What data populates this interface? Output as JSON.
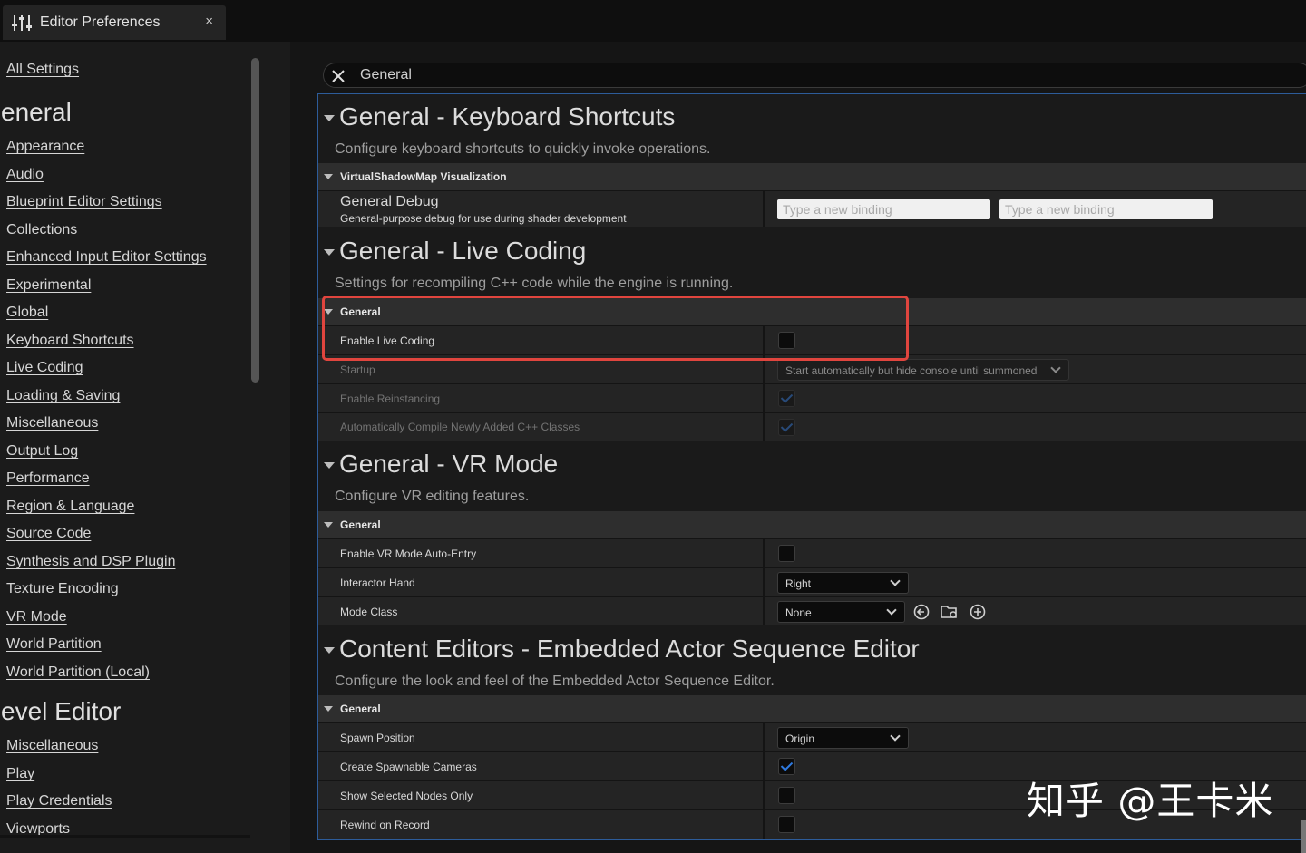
{
  "tab": {
    "title": "Editor Preferences",
    "close": "×"
  },
  "search": {
    "value": "General"
  },
  "sidebar": {
    "all_settings": "All Settings",
    "groups": [
      {
        "heading": "eneral",
        "items": [
          "Appearance",
          "Audio",
          "Blueprint Editor Settings",
          "Collections",
          "Enhanced Input Editor Settings",
          "Experimental",
          "Global",
          "Keyboard Shortcuts",
          "Live Coding",
          "Loading & Saving",
          "Miscellaneous",
          "Output Log",
          "Performance",
          "Region & Language",
          "Source Code",
          "Synthesis and DSP Plugin",
          "Texture Encoding",
          "VR Mode",
          "World Partition",
          "World Partition (Local)"
        ]
      },
      {
        "heading": "evel Editor",
        "items": [
          "Miscellaneous",
          "Play",
          "Play Credentials",
          "Viewports"
        ]
      }
    ]
  },
  "sections": {
    "keyboard": {
      "title": "General - Keyboard Shortcuts",
      "desc": "Configure keyboard shortcuts to quickly invoke operations.",
      "category": "VirtualShadowMap Visualization",
      "row_title": "General Debug",
      "row_sub": "General-purpose debug for use during shader development",
      "binding_placeholder": "Type a new binding"
    },
    "live": {
      "title": "General - Live Coding",
      "desc": "Settings for recompiling C++ code while the engine is running.",
      "category": "General",
      "enable": "Enable Live Coding",
      "startup": "Startup",
      "startup_value": "Start automatically but hide console until summoned",
      "reinstancing": "Enable Reinstancing",
      "autocompile": "Automatically Compile Newly Added C++ Classes"
    },
    "vr": {
      "title": "General - VR Mode",
      "desc": "Configure VR editing features.",
      "category": "General",
      "auto_entry": "Enable VR Mode Auto-Entry",
      "hand": "Interactor Hand",
      "hand_value": "Right",
      "mode_class": "Mode Class",
      "mode_class_value": "None"
    },
    "content": {
      "title": "Content Editors - Embedded Actor Sequence Editor",
      "desc": "Configure the look and feel of the Embedded Actor Sequence Editor.",
      "category": "General",
      "spawn": "Spawn Position",
      "spawn_value": "Origin",
      "cameras": "Create Spawnable Cameras",
      "selected_nodes": "Show Selected Nodes Only",
      "rewind": "Rewind on Record"
    }
  },
  "watermark": "知乎 @王卡米",
  "colors": {
    "accent": "#2f7ae0",
    "highlight": "#e0453e",
    "panel_border": "#2d5c9a"
  }
}
